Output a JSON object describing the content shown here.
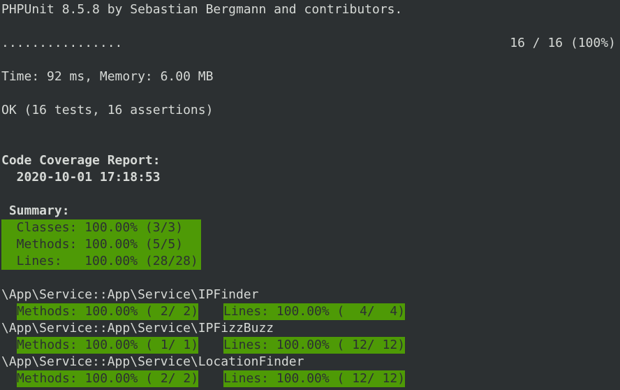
{
  "terminal": {
    "header": "PHPUnit 8.5.8 by Sebastian Bergmann and contributors.",
    "progress_dots": "................",
    "progress_count": "16 / 16 (100%)",
    "time_memory": "Time: 92 ms, Memory: 6.00 MB",
    "result": "OK (16 tests, 16 assertions)",
    "report_title": "Code Coverage Report:",
    "report_date": "  2020-10-01 17:18:53",
    "summary": {
      "title": " Summary:",
      "classes": "  Classes: 100.00% (3/3)",
      "methods": "  Methods: 100.00% (5/5)",
      "lines": "  Lines:   100.00% (28/28)"
    },
    "classes": [
      {
        "name": "\\App\\Service::App\\Service\\IPFinder",
        "methods": "Methods: 100.00% ( 2/ 2)",
        "lines": "Lines: 100.00% (  4/  4)"
      },
      {
        "name": "\\App\\Service::App\\Service\\IPFizzBuzz",
        "methods": "Methods: 100.00% ( 1/ 1)",
        "lines": "Lines: 100.00% ( 12/ 12)"
      },
      {
        "name": "\\App\\Service::App\\Service\\LocationFinder",
        "methods": "Methods: 100.00% ( 2/ 2)",
        "lines": "Lines: 100.00% ( 12/ 12)"
      }
    ],
    "colors": {
      "background": "#2c3032",
      "foreground": "#d6d9d6",
      "coverage_highlight": "#4e9a06"
    }
  }
}
